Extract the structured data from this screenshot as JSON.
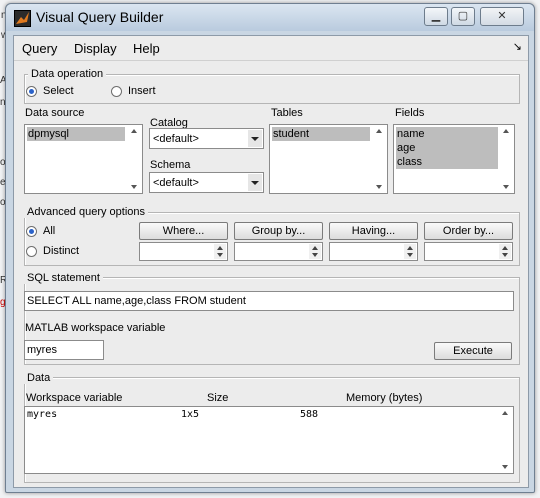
{
  "window": {
    "title": "Visual Query Builder",
    "minimize": "▁",
    "maximize": "▢",
    "close": "✕"
  },
  "menu": [
    {
      "label": "Query"
    },
    {
      "label": "Display"
    },
    {
      "label": "Help"
    }
  ],
  "dock_icon": "↘",
  "data_operation": {
    "title": "Data operation",
    "select_label": "Select",
    "insert_label": "Insert",
    "selected": "Select"
  },
  "data_source": {
    "label": "Data source",
    "items": [
      "dpmysql"
    ],
    "selected": "dpmysql"
  },
  "catalog": {
    "label": "Catalog",
    "value": "<default>"
  },
  "schema": {
    "label": "Schema",
    "value": "<default>"
  },
  "tables": {
    "label": "Tables",
    "items": [
      "student"
    ],
    "selected": "student"
  },
  "fields": {
    "label": "Fields",
    "items": [
      "name",
      "age",
      "class"
    ],
    "selected": [
      "name",
      "age",
      "class"
    ]
  },
  "advanced": {
    "title": "Advanced query options",
    "all_label": "All",
    "distinct_label": "Distinct",
    "selected": "All",
    "buttons": [
      "Where...",
      "Group by...",
      "Having...",
      "Order by..."
    ]
  },
  "sql": {
    "title": "SQL statement",
    "statement": "SELECT ALL name,age,class FROM student"
  },
  "workspace_var": {
    "label": "MATLAB workspace variable",
    "value": "myres",
    "execute_label": "Execute"
  },
  "data_section": {
    "title": "Data",
    "columns": [
      "Workspace variable",
      "Size",
      "Memory (bytes)"
    ],
    "rows": [
      {
        "variable": "myres",
        "size": "1x5",
        "memory": "588"
      }
    ]
  },
  "background_chars": [
    "na",
    "wo",
    "A",
    "n",
    "o",
    "e",
    "o",
    "R",
    "g"
  ],
  "colors": {
    "title_bar": "#c9d6e3",
    "selection": "#bdbdbd",
    "radio_dot": "#2a62c9"
  }
}
